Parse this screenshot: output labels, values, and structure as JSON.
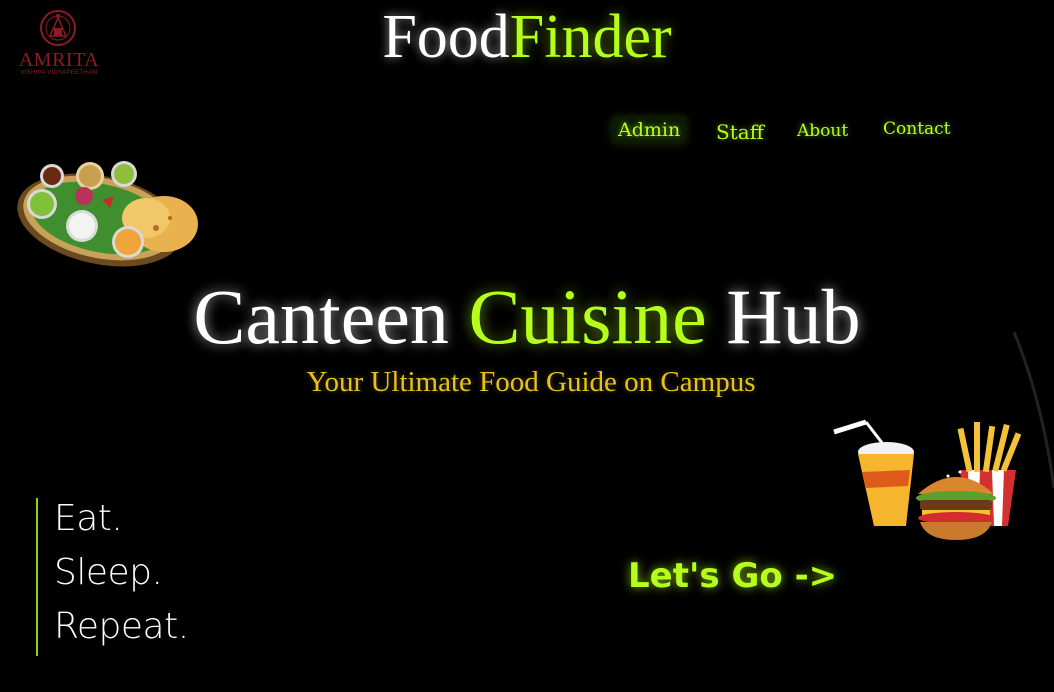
{
  "logo": {
    "name": "AMRITA",
    "subtitle": "VISHWA VIDYAPEETHAM",
    "color": "#8c1c24"
  },
  "brand": {
    "part1": "Food",
    "part2": "Finder"
  },
  "nav": {
    "items": [
      {
        "label": "Admin",
        "active": true
      },
      {
        "label": "Staff",
        "active": false
      },
      {
        "label": "About",
        "active": false
      },
      {
        "label": "Contact",
        "active": false
      }
    ]
  },
  "hero": {
    "title_part1": "Canteen",
    "title_part2": "Cuisine",
    "title_part3": "Hub",
    "tagline": "Your Ultimate Food Guide on Campus"
  },
  "motto": {
    "line1": "Eat.",
    "line2": "Sleep.",
    "line3": "Repeat."
  },
  "cta": {
    "label": "Let's Go ->"
  },
  "images": {
    "left_food": "thali-plate-illustration",
    "right_food": "burger-fries-drink-illustration"
  },
  "colors": {
    "background": "#000000",
    "accent_green": "#b6ff1a",
    "tagline_gold": "#e8c21c",
    "text_white": "#ffffff"
  }
}
